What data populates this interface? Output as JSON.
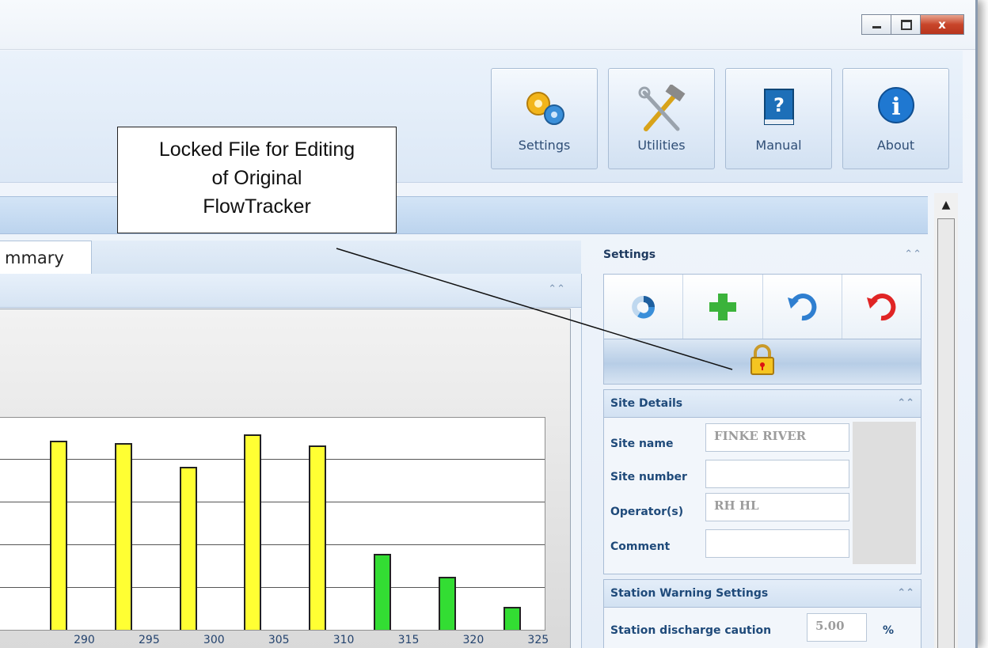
{
  "toolbar": {
    "settings_label": "Settings",
    "utilities_label": "Utilities",
    "manual_label": "Manual",
    "about_label": "About"
  },
  "tabs": {
    "summary_label": "mmary"
  },
  "chart_data": {
    "type": "bar",
    "title": "",
    "xlabel": "",
    "ylabel": "",
    "x_ticks": [
      "290",
      "295",
      "300",
      "305",
      "310",
      "315",
      "320",
      "325"
    ],
    "series": [
      {
        "color": "#ffff33",
        "x": [
          288,
          293,
          298,
          303,
          308
        ],
        "values": [
          0.89,
          0.88,
          0.77,
          0.92,
          0.87
        ]
      },
      {
        "color": "#33dd33",
        "x": [
          313,
          318,
          323
        ],
        "values": [
          0.36,
          0.25,
          0.11
        ]
      }
    ],
    "ylim": [
      0,
      1
    ],
    "xlim": [
      283.5,
      325.5
    ],
    "grid": true
  },
  "side": {
    "settings_title": "Settings",
    "site_details": {
      "title": "Site Details",
      "site_name_label": "Site name",
      "site_name_value": "FINKE RIVER",
      "site_number_label": "Site number",
      "site_number_value": "",
      "operators_label": "Operator(s)",
      "operators_value": "RH HL",
      "comment_label": "Comment",
      "comment_value": ""
    },
    "station_warning": {
      "title": "Station Warning Settings",
      "discharge_caution_label": "Station discharge caution",
      "discharge_caution_value": "5.00",
      "unit": "%"
    }
  },
  "callout": {
    "line1": "Locked File for Editing",
    "line2": "of Original",
    "line3": "FlowTracker"
  },
  "colors": {
    "accent": "#2f4e76",
    "bar_yellow": "#ffff33",
    "bar_green": "#33dd33"
  }
}
